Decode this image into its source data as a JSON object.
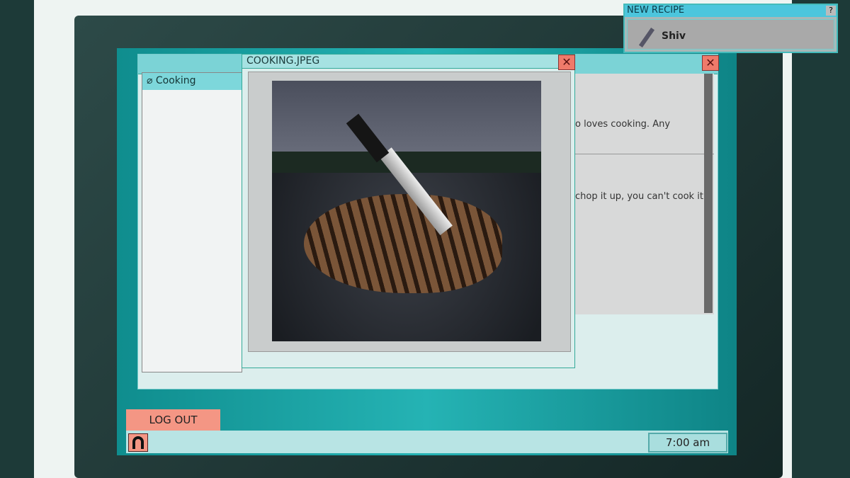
{
  "sidebar": {
    "items": [
      {
        "label": "Cooking",
        "icon": "paperclip-icon"
      }
    ]
  },
  "content": {
    "lines": [
      "o loves cooking. Any",
      "chop it up, you can't cook it."
    ]
  },
  "image_window": {
    "title": "COOKING.JPEG",
    "close": "✕"
  },
  "main_window": {
    "close": "✕"
  },
  "taskbar": {
    "logout": "LOG OUT",
    "clock": "7:00 am"
  },
  "notification": {
    "title": "NEW RECIPE",
    "help": "?",
    "item": "Shiv",
    "item_icon": "shiv-icon"
  }
}
